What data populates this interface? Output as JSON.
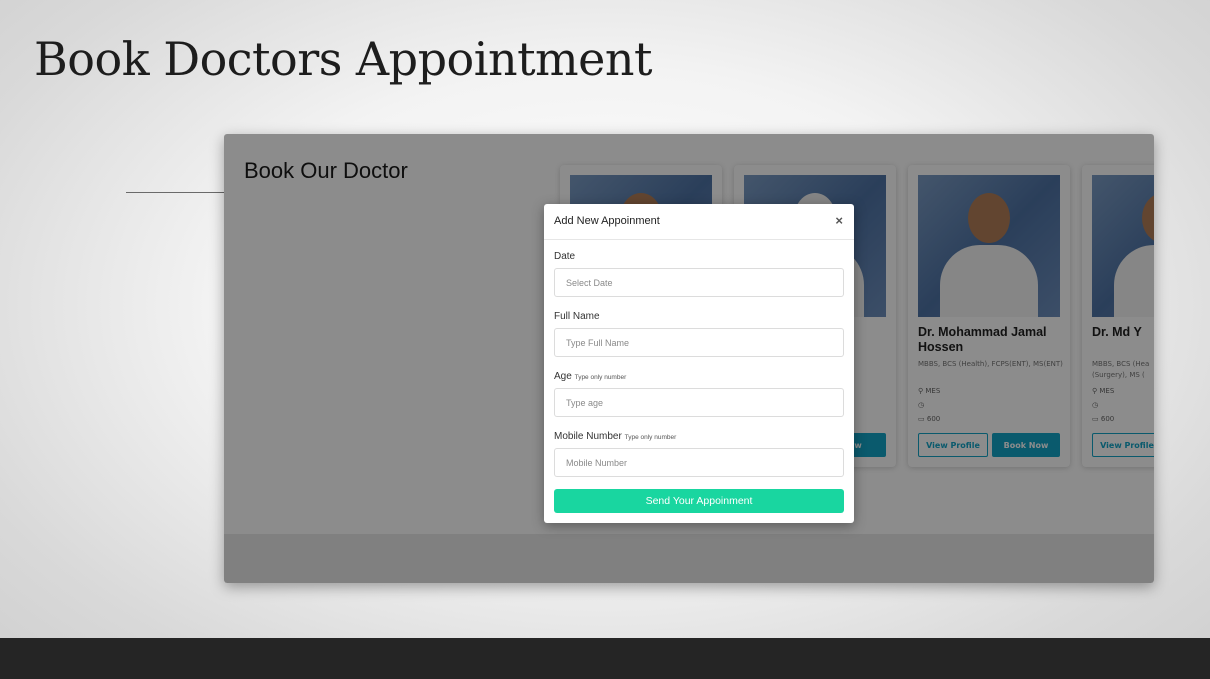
{
  "slide": {
    "title": "Book Doctors Appointment"
  },
  "app": {
    "section_title": "Book Our Doctor",
    "doctors": [
      {
        "name": "",
        "degrees": "",
        "location": "",
        "fee": "",
        "view_label": "",
        "book_label": ""
      },
      {
        "name": "",
        "degrees": "",
        "location": "",
        "fee": "",
        "view_label": "",
        "book_label": "Now"
      },
      {
        "name": "Dr. Mohammad Jamal Hossen",
        "degrees": "MBBS, BCS (Health), FCPS(ENT), MS(ENT)",
        "location": "MES",
        "fee": "600",
        "view_label": "View Profile",
        "book_label": "Book Now"
      },
      {
        "name": "Dr. Md Y",
        "degrees": "MBBS, BCS (Hea (Surgery), MS (",
        "location": "MES",
        "fee": "600",
        "view_label": "View Profile",
        "book_label": ""
      }
    ]
  },
  "modal": {
    "title": "Add New Appoinment",
    "close_symbol": "×",
    "date_label": "Date",
    "date_placeholder": "Select Date",
    "name_label": "Full Name",
    "name_placeholder": "Type Full Name",
    "age_label": "Age",
    "age_hint": "Type only number",
    "age_placeholder": "Type age",
    "mobile_label": "Mobile Number",
    "mobile_hint": "Type only number",
    "mobile_placeholder": "Mobile Number",
    "submit_label": "Send Your Appoinment"
  },
  "icons": {
    "location": "map-pin-icon",
    "time": "clock-icon",
    "fee": "money-icon"
  },
  "colors": {
    "primary": "#13a4c6",
    "submit": "#19d6a0",
    "bottom_bar": "#252525"
  }
}
